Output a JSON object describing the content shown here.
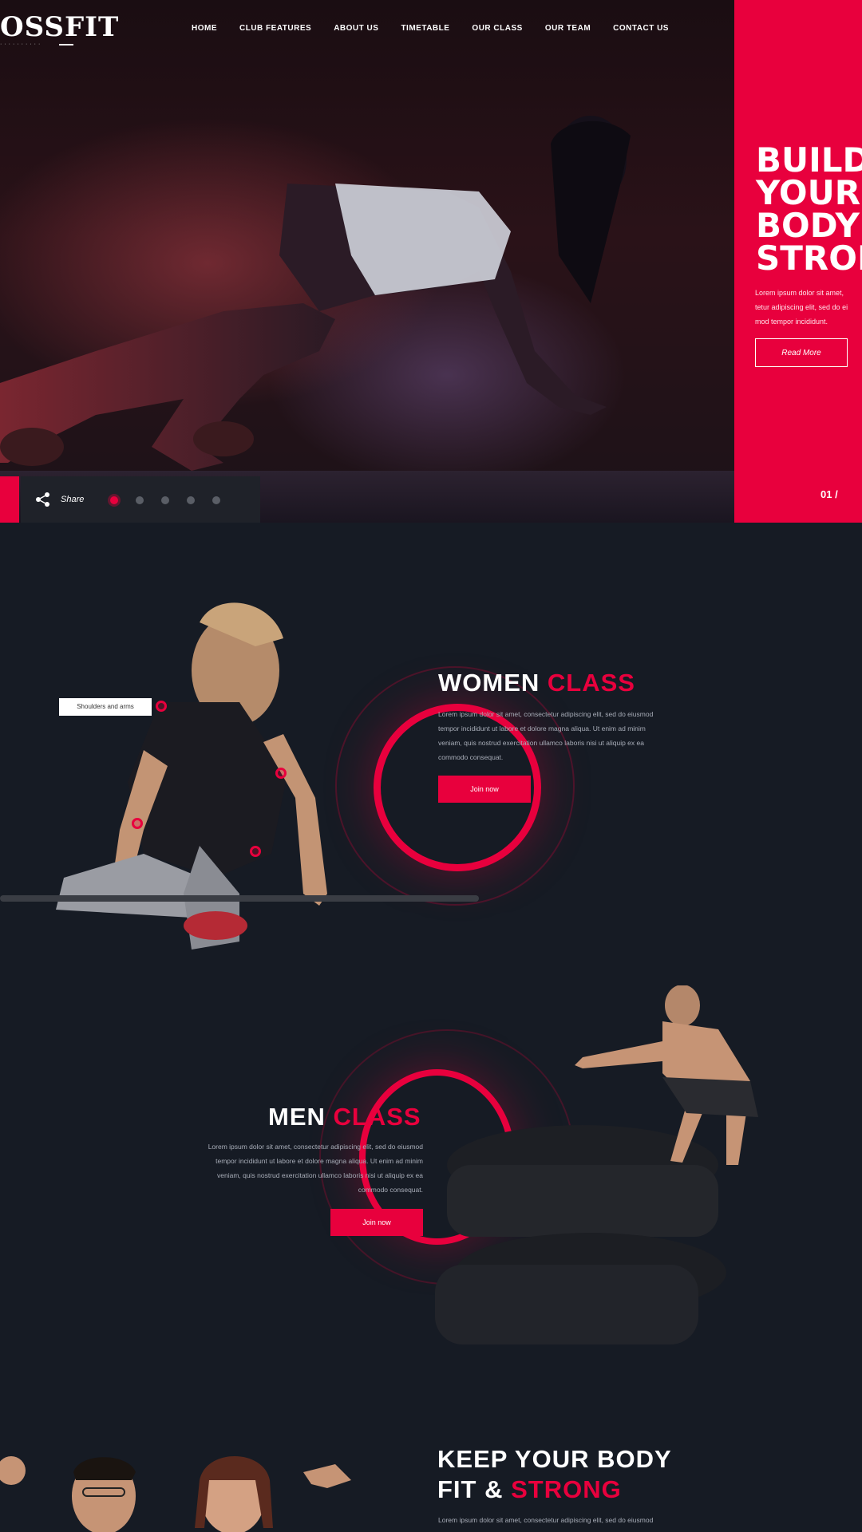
{
  "logo": {
    "text": "OSSFIT",
    "subtitle": "··········"
  },
  "nav": [
    "HOME",
    "CLUB FEATURES",
    "ABOUT US",
    "TIMETABLE",
    "OUR CLASS",
    "OUR TEAM",
    "CONTACT US"
  ],
  "hero": {
    "title_lines": [
      "BUILD",
      "YOUR",
      "BODY",
      "STRON"
    ],
    "text": "Lorem ipsum dolor sit amet,\ntetur adipiscing elit, sed do ei\nmod tempor incididunt.",
    "button": "Read More",
    "counter": "01 /"
  },
  "slider": {
    "share_label": "Share",
    "dot_count": 5,
    "active_index": 0
  },
  "women": {
    "title_plain": "WOMEN",
    "title_accent": "CLASS",
    "text": "Lorem ipsum dolor sit amet, consectetur adipiscing elit, sed do eiusmod\ntempor incididunt ut labore et dolore magna aliqua. Ut enim ad minim\nveniam, quis nostrud exercitation ullamco laboris nisi ut aliquip ex ea\ncommodo consequat.",
    "button": "Join now",
    "tooltip": "Shoulders and arms"
  },
  "men": {
    "title_plain": "MEN",
    "title_accent": "CLASS",
    "text": "Lorem ipsum dolor sit amet, consectetur adipiscing elit, sed do eiusmod\ntempor incididunt ut labore et dolore magna aliqua. Ut enim ad minim\nveniam, quis nostrud exercitation ullamco laboris nisi ut aliquip ex ea\ncommodo consequat.",
    "button": "Join now"
  },
  "keep": {
    "line1": "KEEP YOUR BODY",
    "line2_plain": "FIT &",
    "line2_accent": "STRONG",
    "text": "Lorem ipsum dolor sit amet, consectetur adipiscing elit, sed do eiusmod"
  },
  "colors": {
    "accent": "#e8003d",
    "background": "#161b24"
  }
}
